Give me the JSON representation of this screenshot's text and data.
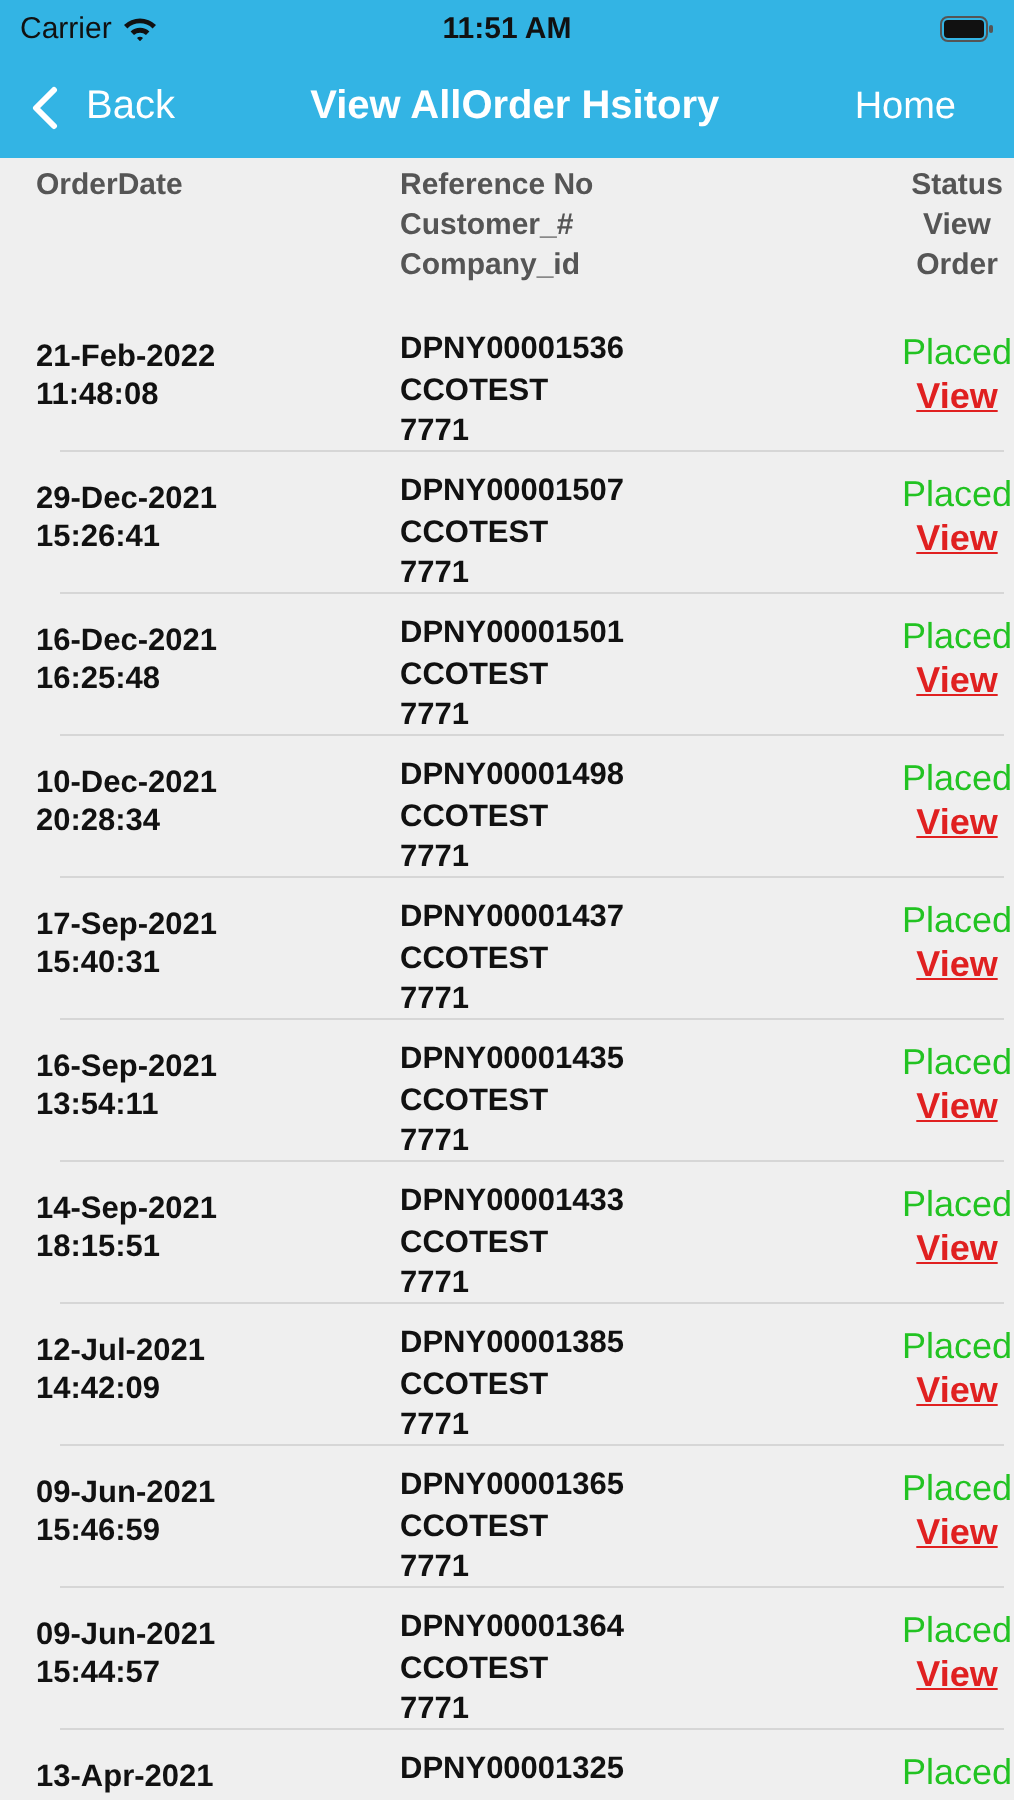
{
  "status_bar": {
    "carrier": "Carrier",
    "time": "11:51 AM"
  },
  "nav": {
    "back": "Back",
    "title": "View AllOrder Hsitory",
    "home": "Home"
  },
  "table": {
    "columns": [
      {
        "lines": [
          "OrderDate"
        ]
      },
      {
        "lines": [
          "Reference No",
          "Customer_#",
          "Company_id"
        ]
      },
      {
        "lines": [
          "Status",
          "View",
          "Order"
        ]
      }
    ],
    "rows": [
      {
        "date": "21-Feb-2022",
        "time": "11:48:08",
        "reference": "DPNY00001536",
        "customer": "CCOTEST",
        "company": "7771",
        "status": "Placed",
        "action": "View"
      },
      {
        "date": "29-Dec-2021",
        "time": "15:26:41",
        "reference": "DPNY00001507",
        "customer": "CCOTEST",
        "company": "7771",
        "status": "Placed",
        "action": "View"
      },
      {
        "date": "16-Dec-2021",
        "time": "16:25:48",
        "reference": "DPNY00001501",
        "customer": "CCOTEST",
        "company": "7771",
        "status": "Placed",
        "action": "View"
      },
      {
        "date": "10-Dec-2021",
        "time": "20:28:34",
        "reference": "DPNY00001498",
        "customer": "CCOTEST",
        "company": "7771",
        "status": "Placed",
        "action": "View"
      },
      {
        "date": "17-Sep-2021",
        "time": "15:40:31",
        "reference": "DPNY00001437",
        "customer": "CCOTEST",
        "company": "7771",
        "status": "Placed",
        "action": "View"
      },
      {
        "date": "16-Sep-2021",
        "time": "13:54:11",
        "reference": "DPNY00001435",
        "customer": "CCOTEST",
        "company": "7771",
        "status": "Placed",
        "action": "View"
      },
      {
        "date": "14-Sep-2021",
        "time": "18:15:51",
        "reference": "DPNY00001433",
        "customer": "CCOTEST",
        "company": "7771",
        "status": "Placed",
        "action": "View"
      },
      {
        "date": "12-Jul-2021",
        "time": "14:42:09",
        "reference": "DPNY00001385",
        "customer": "CCOTEST",
        "company": "7771",
        "status": "Placed",
        "action": "View"
      },
      {
        "date": "09-Jun-2021",
        "time": "15:46:59",
        "reference": "DPNY00001365",
        "customer": "CCOTEST",
        "company": "7771",
        "status": "Placed",
        "action": "View"
      },
      {
        "date": "09-Jun-2021",
        "time": "15:44:57",
        "reference": "DPNY00001364",
        "customer": "CCOTEST",
        "company": "7771",
        "status": "Placed",
        "action": "View"
      },
      {
        "date": "13-Apr-2021",
        "reference": "DPNY00001325",
        "status": "Placed"
      }
    ]
  }
}
